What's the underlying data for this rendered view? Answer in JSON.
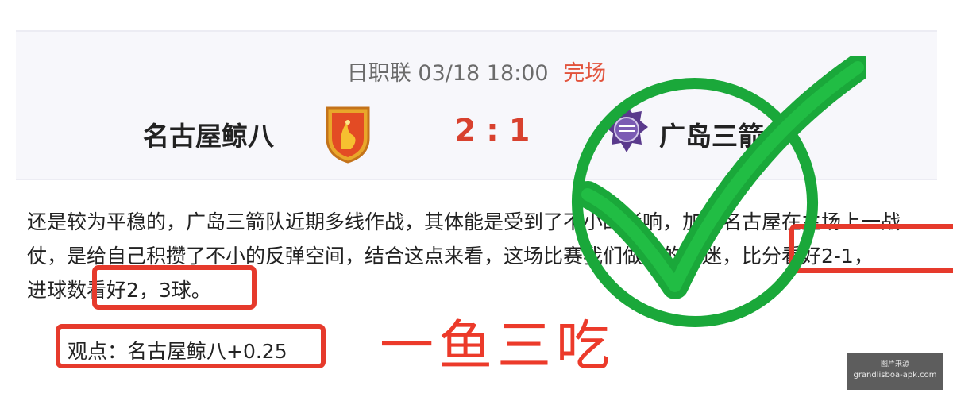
{
  "match": {
    "league": "日职联",
    "datetime": "03/18 18:00",
    "status": "完场",
    "home_team": "名古屋鲸八",
    "score": "2 : 1",
    "away_team": "广岛三箭"
  },
  "article": {
    "line1": "还是较为平稳的，广岛三箭队近期多线作战，其体能是受到了不小的影响，加上名古屋在主场上一战",
    "line2": "仗，是给自己积攒了不小的反弹空间，结合这点来看，这场比赛我们做为的球迷，比分看好2-1，",
    "line3": "进球数看好2，3球。",
    "viewpoint": "观点：名古屋鲸八+0.25"
  },
  "annotation": {
    "slogan": "一鱼三吃",
    "check_icon": "green-check-icon"
  },
  "watermark": {
    "label": "图片来源",
    "site": "grandlisboa-apk.com"
  },
  "colors": {
    "status": "#e2533c",
    "score": "#d8412e",
    "highlight_box": "#e63a2c",
    "check": "#1aa83a"
  }
}
